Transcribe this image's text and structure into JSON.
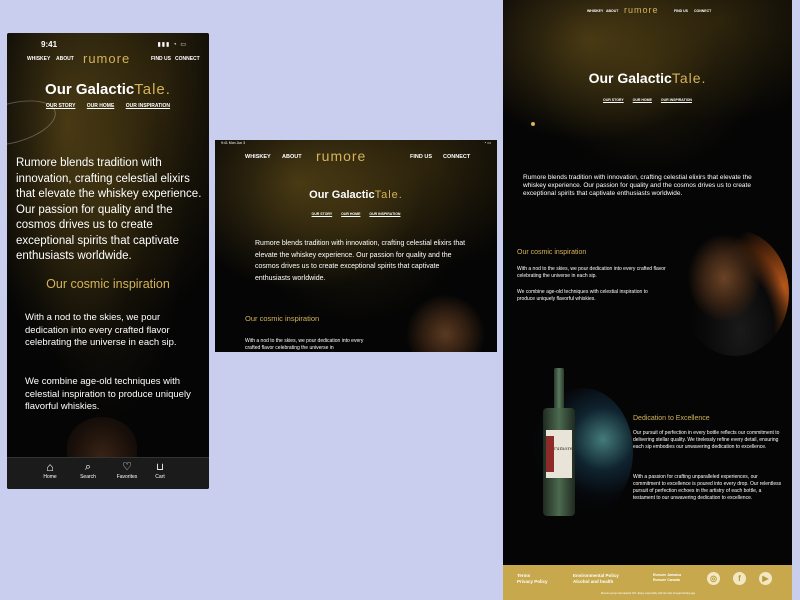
{
  "phone": {
    "status": {
      "time": "9:41"
    },
    "nav": {
      "whiskey": "WHISKEY",
      "about": "ABOUT",
      "logo": "rumore",
      "find_us": "FIND US",
      "connect": "CONNECT"
    },
    "hero": {
      "title_main": "Our Galactic",
      "title_accent": "Tale."
    },
    "subnav": {
      "story": "OUR STORY",
      "home": "OUR HOME",
      "inspiration": "OUR INSPIRATION"
    },
    "intro": "Rumore blends tradition with innovation, crafting celestial elixirs that elevate the whiskey experience. Our passion for quality and the cosmos drives us to create exceptional spirits that captivate enthusiasts worldwide.",
    "inspiration_heading": "Our cosmic inspiration",
    "inspiration_p1": "With a nod to the skies, we pour dedication into every crafted flavor celebrating the universe in each sip.",
    "inspiration_p2": "We combine age-old techniques with celestial inspiration to produce uniquely flavorful whiskies.",
    "tabbar": {
      "home": "Home",
      "search": "Search",
      "favorites": "Favorites",
      "cart": "Cart"
    }
  },
  "tablet": {
    "status": {
      "time": "9:41 Mon Jun 3"
    },
    "nav": {
      "whiskey": "WHISKEY",
      "about": "ABOUT",
      "logo": "rumore",
      "find_us": "FIND US",
      "connect": "CONNECT"
    },
    "hero": {
      "title_main": "Our Galactic",
      "title_accent": "Tale."
    },
    "subnav": {
      "story": "OUR STORY",
      "home": "OUR HOME",
      "inspiration": "OUR INSPIRATION"
    },
    "intro": "Rumore blends tradition with innovation, crafting celestial elixirs that elevate the whiskey experience. Our passion for quality and the cosmos drives us to create exceptional spirits that captivate enthusiasts worldwide.",
    "inspiration_heading": "Our cosmic inspiration",
    "inspiration_p1": "With a nod to the skies, we pour dedication into every crafted flavor celebrating the universe in"
  },
  "desktop": {
    "nav": {
      "whiskey": "WHISKEY",
      "about": "ABOUT",
      "logo": "rumore",
      "find_us": "FIND US",
      "connect": "CONNECT"
    },
    "hero": {
      "title_main": "Our Galactic",
      "title_accent": "Tale."
    },
    "subnav": {
      "story": "OUR STORY",
      "home": "OUR HOME",
      "inspiration": "OUR INSPIRATION"
    },
    "intro": "Rumore blends tradition with innovation, crafting celestial elixirs that elevate the whiskey experience. Our passion for quality and the cosmos drives us to create exceptional spirits that captivate enthusiasts worldwide.",
    "inspiration_heading": "Our cosmic inspiration",
    "inspiration_p1": "With a nod to the skies, we pour dedication into every crafted flavor celebrating the universe in each sip.",
    "inspiration_p2": "We combine age-old techniques with celestial inspiration to produce uniquely flavorful whiskies.",
    "dedication_heading": "Dedication to Excellence",
    "dedication_p1": "Our pursuit of perfection in every bottle reflects our commitment to delivering stellar quality. We tirelessly refine every detail, ensuring each sip embodies our unwavering dedication to excellence.",
    "dedication_p2": "With a passion for crafting unparalleled experiences, our commitment to excellence is poured into every drop. Our relentless pursuit of perfection echoes in the artistry of each bottle, a testament to our unwavering dedication to excellence.",
    "bottle_label": "rumore",
    "footer": {
      "terms": "Terms",
      "privacy": "Privacy Policy",
      "environment": "Environmental Policy",
      "alcohol": "Alcohol and health",
      "region1": "Rumore Jamaica",
      "region2": "Rumore Canada",
      "legal": "Rumore group international LTD. Enjoy responsibly with the help of legal drinking age"
    }
  },
  "colors": {
    "gold": "#d6b35a",
    "footer_bg": "#c7a84d",
    "frame_bg": "#050505",
    "page_bg": "#c9cdee"
  }
}
